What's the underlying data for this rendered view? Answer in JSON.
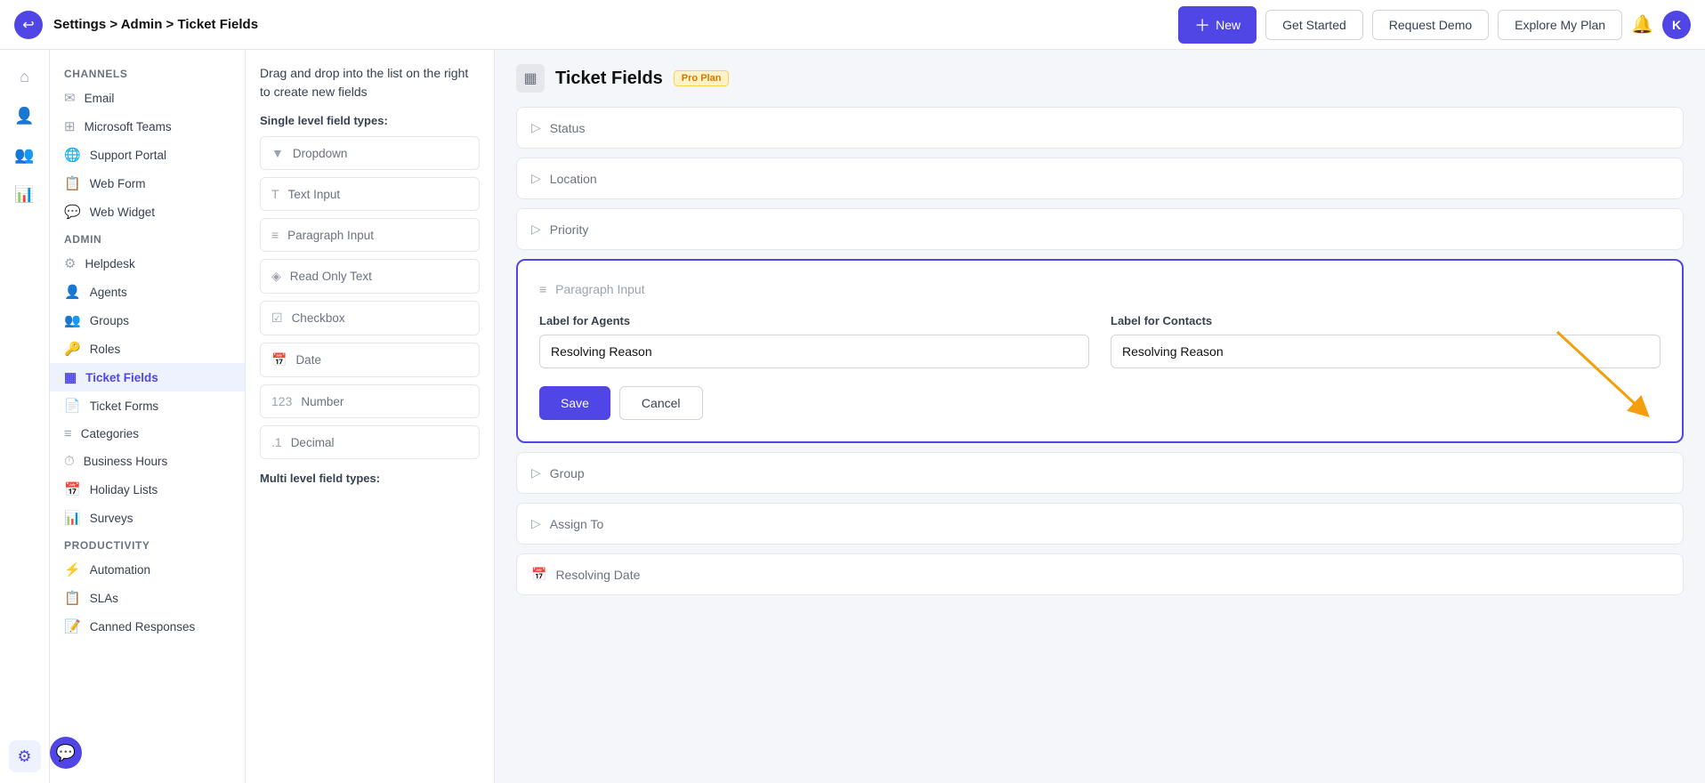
{
  "topbar": {
    "breadcrumb": "Settings > Admin > Ticket Fields",
    "new_label": "New",
    "get_started_label": "Get Started",
    "request_demo_label": "Request Demo",
    "explore_plan_label": "Explore My Plan",
    "avatar_initials": "K"
  },
  "icon_sidebar": {
    "icons": [
      {
        "name": "home-icon",
        "symbol": "⌂",
        "active": false
      },
      {
        "name": "contacts-icon",
        "symbol": "👤",
        "active": false
      },
      {
        "name": "team-icon",
        "symbol": "👥",
        "active": false
      },
      {
        "name": "reports-icon",
        "symbol": "📊",
        "active": false
      },
      {
        "name": "settings-icon",
        "symbol": "⚙",
        "active": true
      }
    ]
  },
  "left_nav": {
    "channels_label": "Channels",
    "channels": [
      {
        "label": "Email",
        "icon": "✉"
      },
      {
        "label": "Microsoft Teams",
        "icon": "⊞"
      },
      {
        "label": "Support Portal",
        "icon": "🌐"
      },
      {
        "label": "Web Form",
        "icon": "📋"
      },
      {
        "label": "Web Widget",
        "icon": "💬"
      }
    ],
    "admin_label": "Admin",
    "admin_items": [
      {
        "label": "Helpdesk",
        "icon": "⚙",
        "active": false
      },
      {
        "label": "Agents",
        "icon": "👤",
        "active": false
      },
      {
        "label": "Groups",
        "icon": "👥",
        "active": false
      },
      {
        "label": "Roles",
        "icon": "🔑",
        "active": false
      },
      {
        "label": "Ticket Fields",
        "icon": "▦",
        "active": true
      },
      {
        "label": "Ticket Forms",
        "icon": "📄",
        "active": false
      },
      {
        "label": "Categories",
        "icon": "≡",
        "active": false
      },
      {
        "label": "Business Hours",
        "icon": "⏱",
        "active": false
      },
      {
        "label": "Holiday Lists",
        "icon": "📅",
        "active": false
      },
      {
        "label": "Surveys",
        "icon": "📊",
        "active": false
      }
    ],
    "productivity_label": "Productivity",
    "productivity_items": [
      {
        "label": "Automation",
        "icon": "⚡",
        "active": false
      },
      {
        "label": "SLAs",
        "icon": "📋",
        "active": false
      },
      {
        "label": "Canned Responses",
        "icon": "📝",
        "active": false
      }
    ]
  },
  "fields_panel": {
    "drag_instruction": "Drag and drop into the list on the right to create new fields",
    "single_level_label": "Single level field types:",
    "single_fields": [
      {
        "label": "Dropdown",
        "icon": "▼"
      },
      {
        "label": "Text Input",
        "icon": "T"
      },
      {
        "label": "Paragraph Input",
        "icon": "≡"
      },
      {
        "label": "Read Only Text",
        "icon": "◈"
      },
      {
        "label": "Checkbox",
        "icon": "☑"
      },
      {
        "label": "Date",
        "icon": "📅"
      },
      {
        "label": "Number",
        "icon": "123"
      },
      {
        "label": "Decimal",
        "icon": ".1"
      }
    ],
    "multi_level_label": "Multi level field types:"
  },
  "ticket_fields_main": {
    "page_icon": "▦",
    "page_title": "Ticket Fields",
    "badge": "Pro Plan",
    "field_rows": [
      {
        "label": "Status",
        "icon": "▷"
      },
      {
        "label": "Location",
        "icon": "▷"
      },
      {
        "label": "Priority",
        "icon": "▷"
      }
    ],
    "popup": {
      "header_label": "Paragraph Input",
      "header_icon": "≡",
      "label_agents": "Label for Agents",
      "label_contacts": "Label for Contacts",
      "agents_value": "Resolving Reason",
      "contacts_value": "Resolving Reason",
      "save_label": "Save",
      "cancel_label": "Cancel"
    },
    "bottom_rows": [
      {
        "label": "Group",
        "icon": "▷"
      },
      {
        "label": "Assign To",
        "icon": "▷"
      },
      {
        "label": "Resolving Date",
        "icon": "📅"
      }
    ]
  }
}
